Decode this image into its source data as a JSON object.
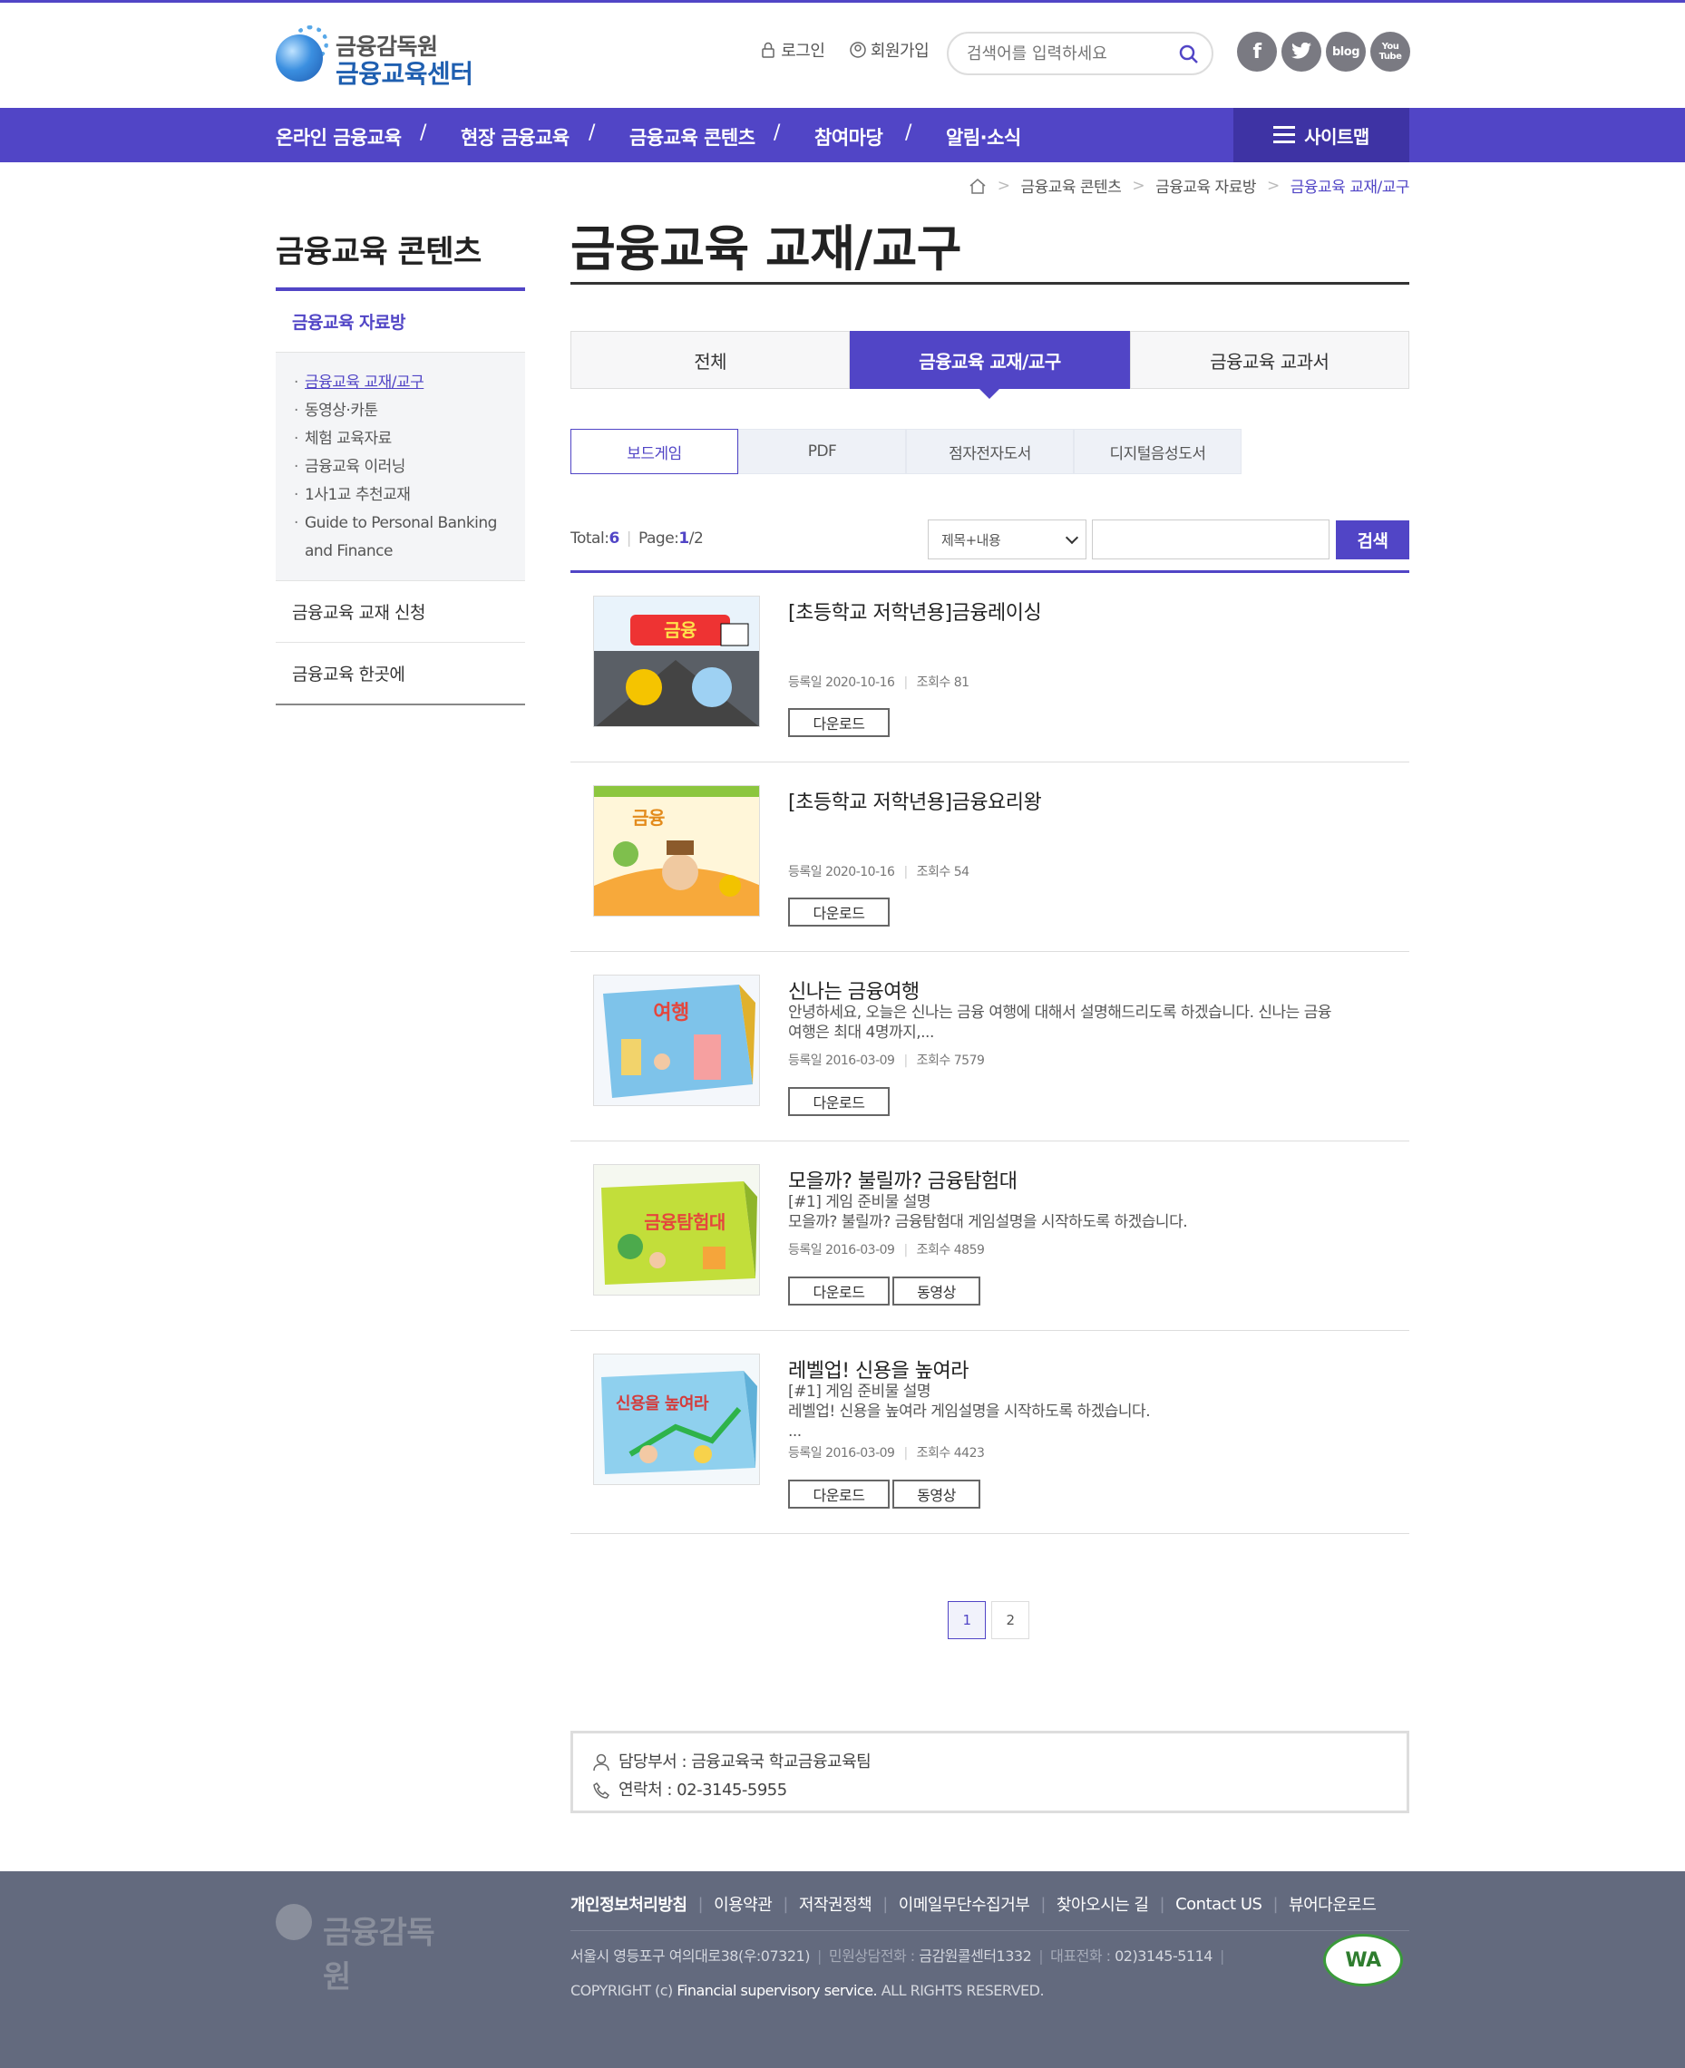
{
  "header": {
    "logo_top": "금융감독원",
    "logo_bottom": "금융교육센터",
    "login": "로그인",
    "join": "회원가입",
    "search_placeholder": "검색어를 입력하세요",
    "sns": [
      "f",
      "t",
      "blog",
      "You Tube"
    ]
  },
  "gnb": {
    "items": [
      "온라인 금융교육",
      "현장 금융교육",
      "금융교육 콘텐츠",
      "참여마당",
      "알림·소식"
    ],
    "sitemap": "사이트맵"
  },
  "breadcrumb": [
    "금융교육 콘텐츠",
    "금융교육 자료방",
    "금융교육 교재/교구"
  ],
  "lnb": {
    "title": "금융교육 콘텐츠",
    "menu1": "금융교육 자료방",
    "sub": [
      "금융교육 교재/교구",
      "동영상·카툰",
      "체험 교육자료",
      "금융교육 이러닝",
      "1사1교 추천교재",
      "Guide to Personal Banking and Finance"
    ],
    "menu2": "금융교육 교재 신청",
    "menu3": "금융교육 한곳에"
  },
  "page_title": "금융교육 교재/교구",
  "tabs": [
    "전체",
    "금융교육 교재/교구",
    "금융교육 교과서"
  ],
  "subtabs": [
    "보드게임",
    "PDF",
    "점자전자도서",
    "디지털음성도서"
  ],
  "listinfo": {
    "total_label": "Total:",
    "total": "6",
    "page_label": "Page:",
    "page": "1",
    "page_total": "/2"
  },
  "search": {
    "select": "제목+내용",
    "button": "검색"
  },
  "items": [
    {
      "title": "[초등학교 저학년용]금융레이싱",
      "desc1": "",
      "desc2": "",
      "desc3": "",
      "date": "등록일 2020-10-16",
      "views": "조회수 81",
      "btn1": "다운로드",
      "btn2": ""
    },
    {
      "title": "[초등학교 저학년용]금융요리왕",
      "desc1": "",
      "desc2": "",
      "desc3": "",
      "date": "등록일 2020-10-16",
      "views": "조회수 54",
      "btn1": "다운로드",
      "btn2": ""
    },
    {
      "title": "신나는 금융여행",
      "desc1": "안녕하세요, 오늘은 신나는 금융 여행에 대해서 설명해드리도록 하겠습니다. 신나는 금융 여행은 최대 4명까지,...",
      "desc2": "",
      "desc3": "",
      "date": "등록일 2016-03-09",
      "views": "조회수 7579",
      "btn1": "다운로드",
      "btn2": ""
    },
    {
      "title": "모을까? 불릴까? 금융탐험대",
      "desc1": "[#1] 게임 준비물 설명",
      "desc2": "모을까? 불릴까? 금융탐험대 게임설명을 시작하도록 하겠습니다.",
      "desc3": "",
      "date": "등록일 2016-03-09",
      "views": "조회수 4859",
      "btn1": "다운로드",
      "btn2": "동영상"
    },
    {
      "title": "레벨업! 신용을 높여라",
      "desc1": "[#1] 게임 준비물 설명",
      "desc2": "레벨업! 신용을 높여라 게임설명을 시작하도록 하겠습니다.",
      "desc3": "...",
      "date": "등록일 2016-03-09",
      "views": "조회수 4423",
      "btn1": "다운로드",
      "btn2": "동영상"
    }
  ],
  "paging": [
    "1",
    "2"
  ],
  "contact": {
    "dept": "담당부서 : 금융교육국 학교금융교육팀",
    "tel": "연락처 : 02-3145-5955"
  },
  "footer": {
    "logo": "금융감독원",
    "links": [
      "개인정보처리방침",
      "이용약관",
      "저작권정책",
      "이메일무단수집거부",
      "찾아오시는 길",
      "Contact US",
      "뷰어다운로드"
    ],
    "address": "서울시 영등포구 여의대로38(우:07321)",
    "counsel_label": "민원상담전화 :",
    "counsel": "금감원콜센터1332",
    "rep_label": "대표전화 :",
    "rep": "02)3145-5114",
    "copy1": "COPYRIGHT (c)",
    "copy2": "Financial supervisory service.",
    "copy3": "ALL RIGHTS RESERVED.",
    "wa": "WA"
  }
}
